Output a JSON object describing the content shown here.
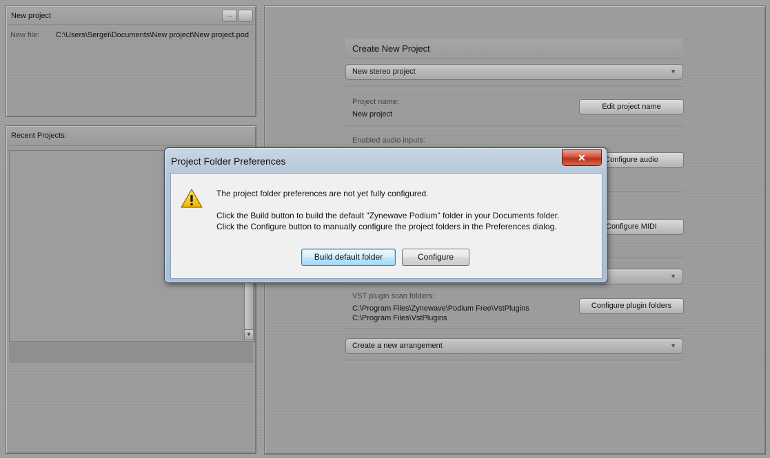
{
  "left_top_panel": {
    "title": "New project",
    "buttons": [
      "...",
      ""
    ],
    "new_file_label": "New file:",
    "new_file_path": "C:\\Users\\Sergei\\Documents\\New project\\New project.pod"
  },
  "recent_panel": {
    "title": "Recent Projects:"
  },
  "create_panel": {
    "title": "Create New Project",
    "template_select": "New stereo project",
    "project_name_label": "Project name:",
    "project_name_value": "New project",
    "edit_name_button": "Edit project name",
    "audio_inputs_label": "Enabled audio inputs:",
    "configure_audio_button": "Configure audio",
    "configure_midi_button": "Configure MIDI",
    "vst_label": "VST plugin scan folders:",
    "vst_folders": [
      "C:\\Program Files\\Zynewave\\Podium Free\\VstPlugins",
      "C:\\Program Files\\VstPlugins"
    ],
    "configure_plugins_button": "Configure plugin folders",
    "arrangement_select": "Create a new arrangement"
  },
  "dialog": {
    "title": "Project Folder Preferences",
    "close_label": "✕",
    "line1": "The project folder preferences are not yet fully configured.",
    "line2": "Click the Build button to build the default \"Zynewave Podium\" folder in your Documents folder.",
    "line3": "Click the Configure button to manually configure the project folders in the Preferences dialog.",
    "build_button": "Build default folder",
    "configure_button": "Configure",
    "icon": "warning-icon"
  },
  "colors": {
    "close_red": "#c83f28",
    "default_button_blue": "#3c7fb1",
    "warning_yellow": "#f5c400"
  }
}
